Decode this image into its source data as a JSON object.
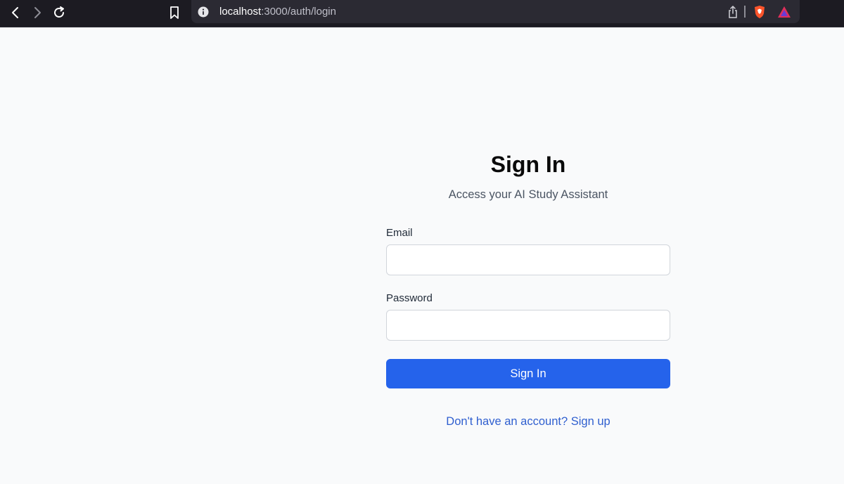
{
  "browser": {
    "url_host": "localhost",
    "url_path": ":3000/auth/login",
    "icons": [
      "back-icon",
      "forward-icon",
      "reload-icon",
      "bookmark-icon",
      "info-icon",
      "share-icon",
      "brave-shields-icon",
      "brave-rewards-icon"
    ]
  },
  "login": {
    "title": "Sign In",
    "subtitle": "Access your AI Study Assistant",
    "email_label": "Email",
    "email_value": "",
    "password_label": "Password",
    "password_value": "",
    "submit_label": "Sign In",
    "signup_link": "Don't have an account? Sign up"
  },
  "colors": {
    "primary": "#2563eb",
    "link": "#2f5fcf",
    "background": "#f9fafb",
    "chrome": "#1c1b22"
  }
}
